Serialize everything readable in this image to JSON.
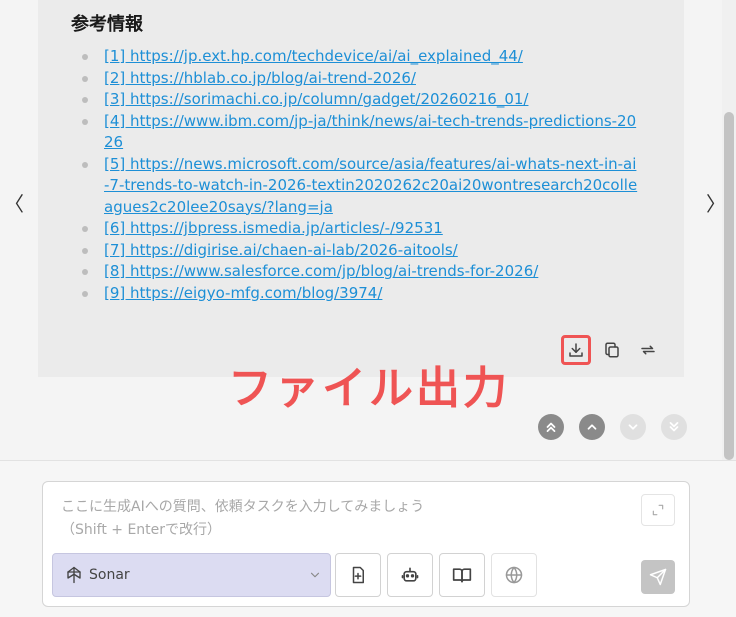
{
  "chat": {
    "nav_prev": "〈",
    "nav_next": "〉",
    "section_title": "参考情報",
    "references": [
      {
        "text": "[1] https://jp.ext.hp.com/techdevice/ai/ai_explained_44/"
      },
      {
        "text": "[2] https://hblab.co.jp/blog/ai-trend-2026/"
      },
      {
        "text": "[3] https://sorimachi.co.jp/column/gadget/20260216_01/"
      },
      {
        "text": "[4] https://www.ibm.com/jp-ja/think/news/ai-tech-trends-predictions-2026"
      },
      {
        "text": "[5] https://news.microsoft.com/source/asia/features/ai-whats-next-in-ai-7-trends-to-watch-in-2026-textin2020262c20ai20wontresearch20colleagues2c20lee20says/?lang=ja"
      },
      {
        "text": "[6] https://jbpress.ismedia.jp/articles/-/92531"
      },
      {
        "text": "[7] https://digirise.ai/chaen-ai-lab/2026-aitools/"
      },
      {
        "text": "[8] https://www.salesforce.com/jp/blog/ai-trends-for-2026/"
      },
      {
        "text": "[9] https://eigyo-mfg.com/blog/3974/"
      }
    ],
    "annotation": "ファイル出力"
  },
  "input": {
    "placeholder_line1": "ここに生成AIへの質問、依頼タスクを入力してみましょう",
    "placeholder_line2": "（Shift + Enterで改行）",
    "model_name": "Sonar"
  },
  "colors": {
    "link": "#1d8fd6",
    "highlight": "#ef5454",
    "model_bg": "#dcdcf2"
  },
  "icons": {
    "download": "download-icon",
    "copy": "copy-icon",
    "regenerate": "repeat-icon",
    "scroll_top": "double-chevron-up-icon",
    "scroll_up": "chevron-up-icon",
    "scroll_down": "chevron-down-icon",
    "scroll_bottom": "double-chevron-down-icon",
    "expand": "expand-icon",
    "model": "perplexity-icon",
    "attach": "file-plus-icon",
    "agent": "robot-icon",
    "prompts": "book-icon",
    "web": "globe-icon",
    "send": "send-icon"
  }
}
